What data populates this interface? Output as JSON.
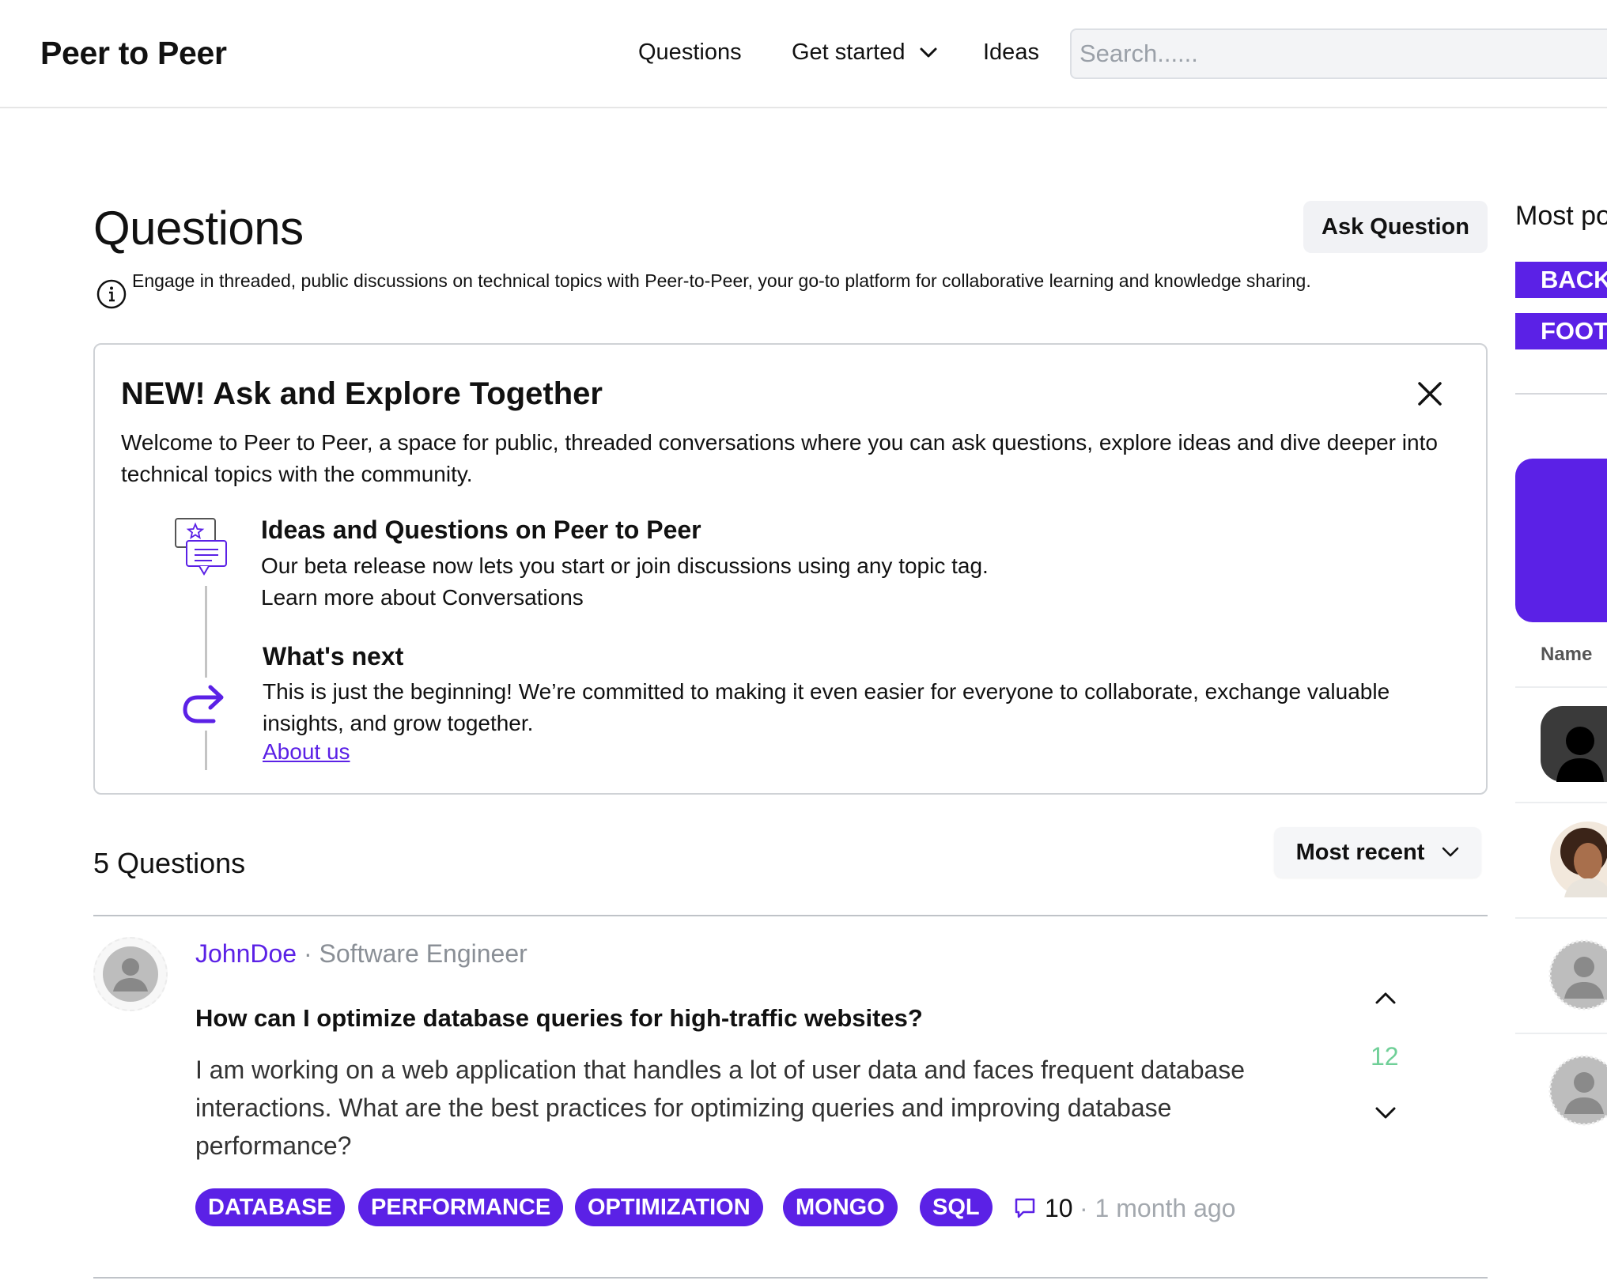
{
  "nav": {
    "brand": "Peer to Peer",
    "items": [
      {
        "label": "Questions"
      },
      {
        "label": "Get started"
      },
      {
        "label": "Ideas"
      }
    ],
    "search_placeholder": "Search......"
  },
  "main": {
    "title": "Questions",
    "ask_button": "Ask Question",
    "info_text": "Engage in threaded, public discussions on technical topics with Peer-to-Peer, your go-to platform for collaborative learning and knowledge sharing.",
    "promo": {
      "title": "NEW! Ask and Explore Together",
      "description": "Welcome to Peer to Peer, a space for public, threaded conversations where you can ask questions, explore ideas and dive deeper into technical topics with the community.",
      "features": [
        {
          "title": "Ideas and Questions on Peer to Peer",
          "line1": "Our beta release now lets you start or join discussions using any topic tag.",
          "line2": "Learn more about Conversations"
        },
        {
          "title": "What's next",
          "body": "This is just the beginning! We’re committed to making it even easier for everyone to collaborate, exchange valuable insights, and grow together.",
          "link": "About us"
        }
      ]
    },
    "count_label": "5 Questions",
    "sort_label": "Most recent",
    "questions": [
      {
        "author": "JohnDoe",
        "separator": "·",
        "role": "Software Engineer",
        "title": "How can I optimize database queries for high-traffic websites?",
        "body": "I am working on a web application that handles a lot of user data and faces frequent database interactions. What are the best practices for optimizing queries and improving database performance?",
        "votes": "12",
        "tags": [
          "DATABASE",
          "PERFORMANCE",
          "OPTIMIZATION",
          "MONGO",
          "SQL"
        ],
        "comments": "10",
        "time": "· 1 month ago"
      }
    ]
  },
  "sidebar": {
    "title": "Most po",
    "tags": [
      "BACK",
      "FOOT"
    ],
    "name_header": "Name"
  },
  "colors": {
    "accent": "#5b21e6",
    "vote_positive": "#6fcf97",
    "muted": "#8a8f96"
  }
}
